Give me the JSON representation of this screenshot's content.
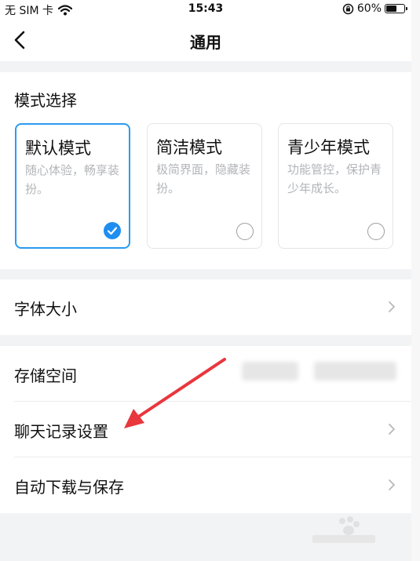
{
  "status_bar": {
    "carrier": "无 SIM 卡",
    "time": "15:43",
    "battery_percent": "60%",
    "battery_level": 0.6
  },
  "nav": {
    "title": "通用",
    "back_icon": "chevron-left-icon"
  },
  "mode_section": {
    "title": "模式选择",
    "options": [
      {
        "name": "默认模式",
        "desc": "随心体验，畅享装扮。",
        "selected": true
      },
      {
        "name": "简洁模式",
        "desc": "极简界面，隐藏装扮。",
        "selected": false
      },
      {
        "name": "青少年模式",
        "desc": "功能管控，保护青少年成长。",
        "selected": false
      }
    ]
  },
  "font_group": {
    "font_size_label": "字体大小"
  },
  "storage_group": {
    "storage_label": "存储空间",
    "chat_history_label": "聊天记录设置",
    "auto_download_label": "自动下载与保存"
  },
  "colors": {
    "accent": "#1f8ef0",
    "annotation_arrow": "#e8373d",
    "background": "#f2f3f5"
  }
}
